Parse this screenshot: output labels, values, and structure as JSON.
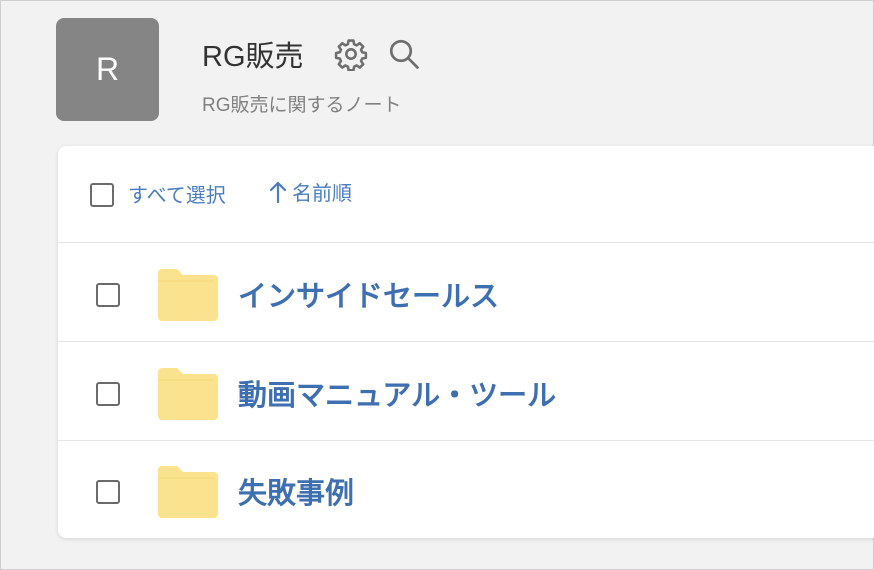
{
  "notebook": {
    "avatar_letter": "R",
    "title": "RG販売",
    "subtitle": "RG販売に関するノート",
    "icons": [
      "gear-icon",
      "search-icon"
    ]
  },
  "toolbar": {
    "select_all_label": "すべて選択",
    "sort_label": "名前順",
    "sort_icon": "arrow-up-icon"
  },
  "folders": [
    {
      "name": "インサイドセールス",
      "icon": "folder-icon"
    },
    {
      "name": "動画マニュアル・ツール",
      "icon": "folder-icon"
    },
    {
      "name": "失敗事例",
      "icon": "folder-icon"
    }
  ],
  "colors": {
    "link_blue": "#4a7dbf",
    "folder_name_blue": "#3e6fb0",
    "folder_yellow": "#fbe28f",
    "avatar_gray": "#858585",
    "background": "#f2f2f2"
  }
}
